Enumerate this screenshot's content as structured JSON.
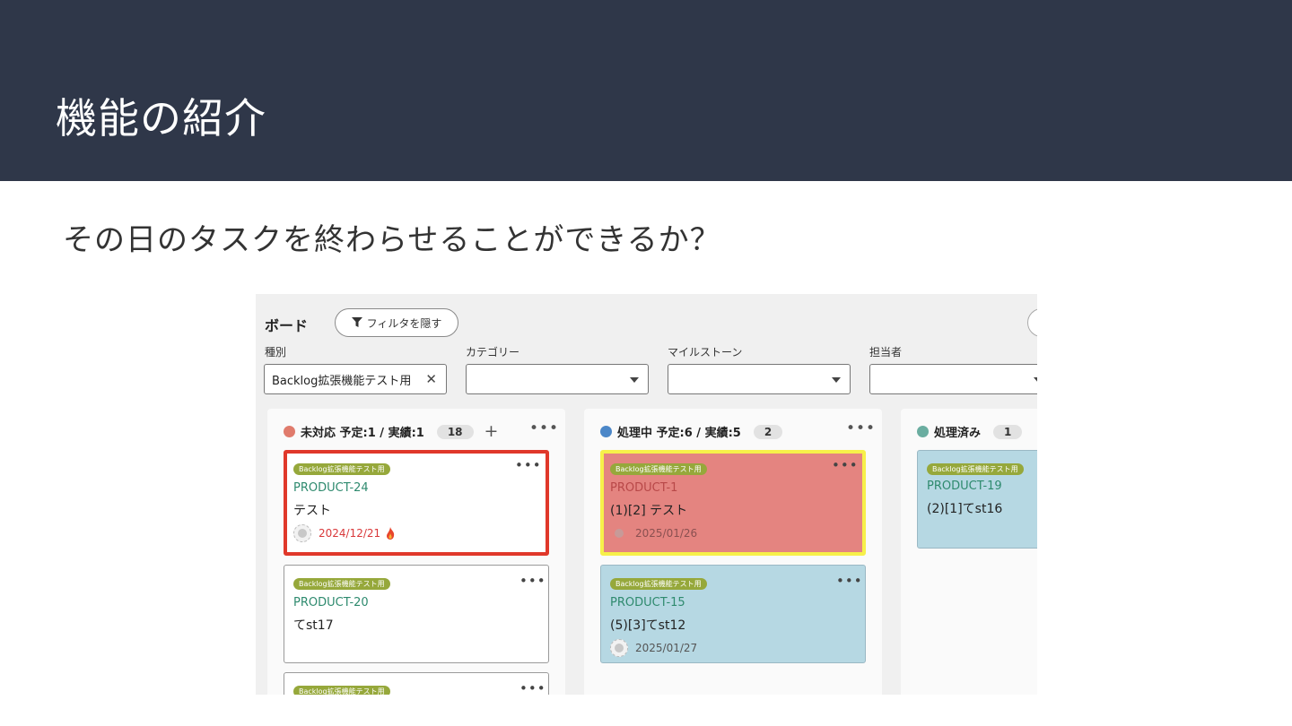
{
  "slide": {
    "title": "機能の紹介",
    "subtitle": "その日のタスクを終わらせることができるか？"
  },
  "board": {
    "title": "ボード",
    "filter_button_label": "フィルタを隠す",
    "filters": [
      {
        "label": "種別",
        "value": "Backlog拡張機能テスト用"
      },
      {
        "label": "カテゴリー",
        "value": ""
      },
      {
        "label": "マイルストーン",
        "value": ""
      },
      {
        "label": "担当者",
        "value": ""
      }
    ]
  },
  "columns": [
    {
      "title": "未対応 予定:1 / 実績:1",
      "count": "18",
      "color": "#e07b6c",
      "cards": [
        {
          "tag": "Backlog拡張機能テスト用",
          "key": "PRODUCT-24",
          "name": "テスト",
          "date": "2024/12/21",
          "date_color": "#d9383a",
          "bg": "#ffffff",
          "border": "#e0382a",
          "overdue": true
        },
        {
          "tag": "Backlog拡張機能テスト用",
          "key": "PRODUCT-20",
          "name": "てst17",
          "date": "",
          "bg": "#ffffff",
          "border": "#9a9a9a"
        },
        {
          "tag": "Backlog拡張機能テスト用",
          "key": "",
          "name": "",
          "date": "",
          "bg": "#ffffff",
          "border": "#9a9a9a"
        }
      ]
    },
    {
      "title": "処理中 予定:6 / 実績:5",
      "count": "2",
      "color": "#4b87c8",
      "cards": [
        {
          "tag": "Backlog拡張機能テスト用",
          "key": "PRODUCT-1",
          "name": "(1)[2] テスト",
          "date": "2025/01/26",
          "date_color": "#8a5050",
          "bg": "#e48480",
          "border": "#f7f04a"
        },
        {
          "tag": "Backlog拡張機能テスト用",
          "key": "PRODUCT-15",
          "name": "(5)[3]てst12",
          "date": "2025/01/27",
          "date_color": "#555555",
          "bg": "#b6d8e3",
          "border": "#9ab8c4"
        }
      ]
    },
    {
      "title": "処理済み",
      "count": "1",
      "color": "#6aada0",
      "cards": [
        {
          "tag": "Backlog拡張機能テスト用",
          "key": "PRODUCT-19",
          "name": "(2)[1]てst16",
          "date": "",
          "bg": "#b6d8e3",
          "border": "#9ab8c4"
        }
      ]
    }
  ]
}
